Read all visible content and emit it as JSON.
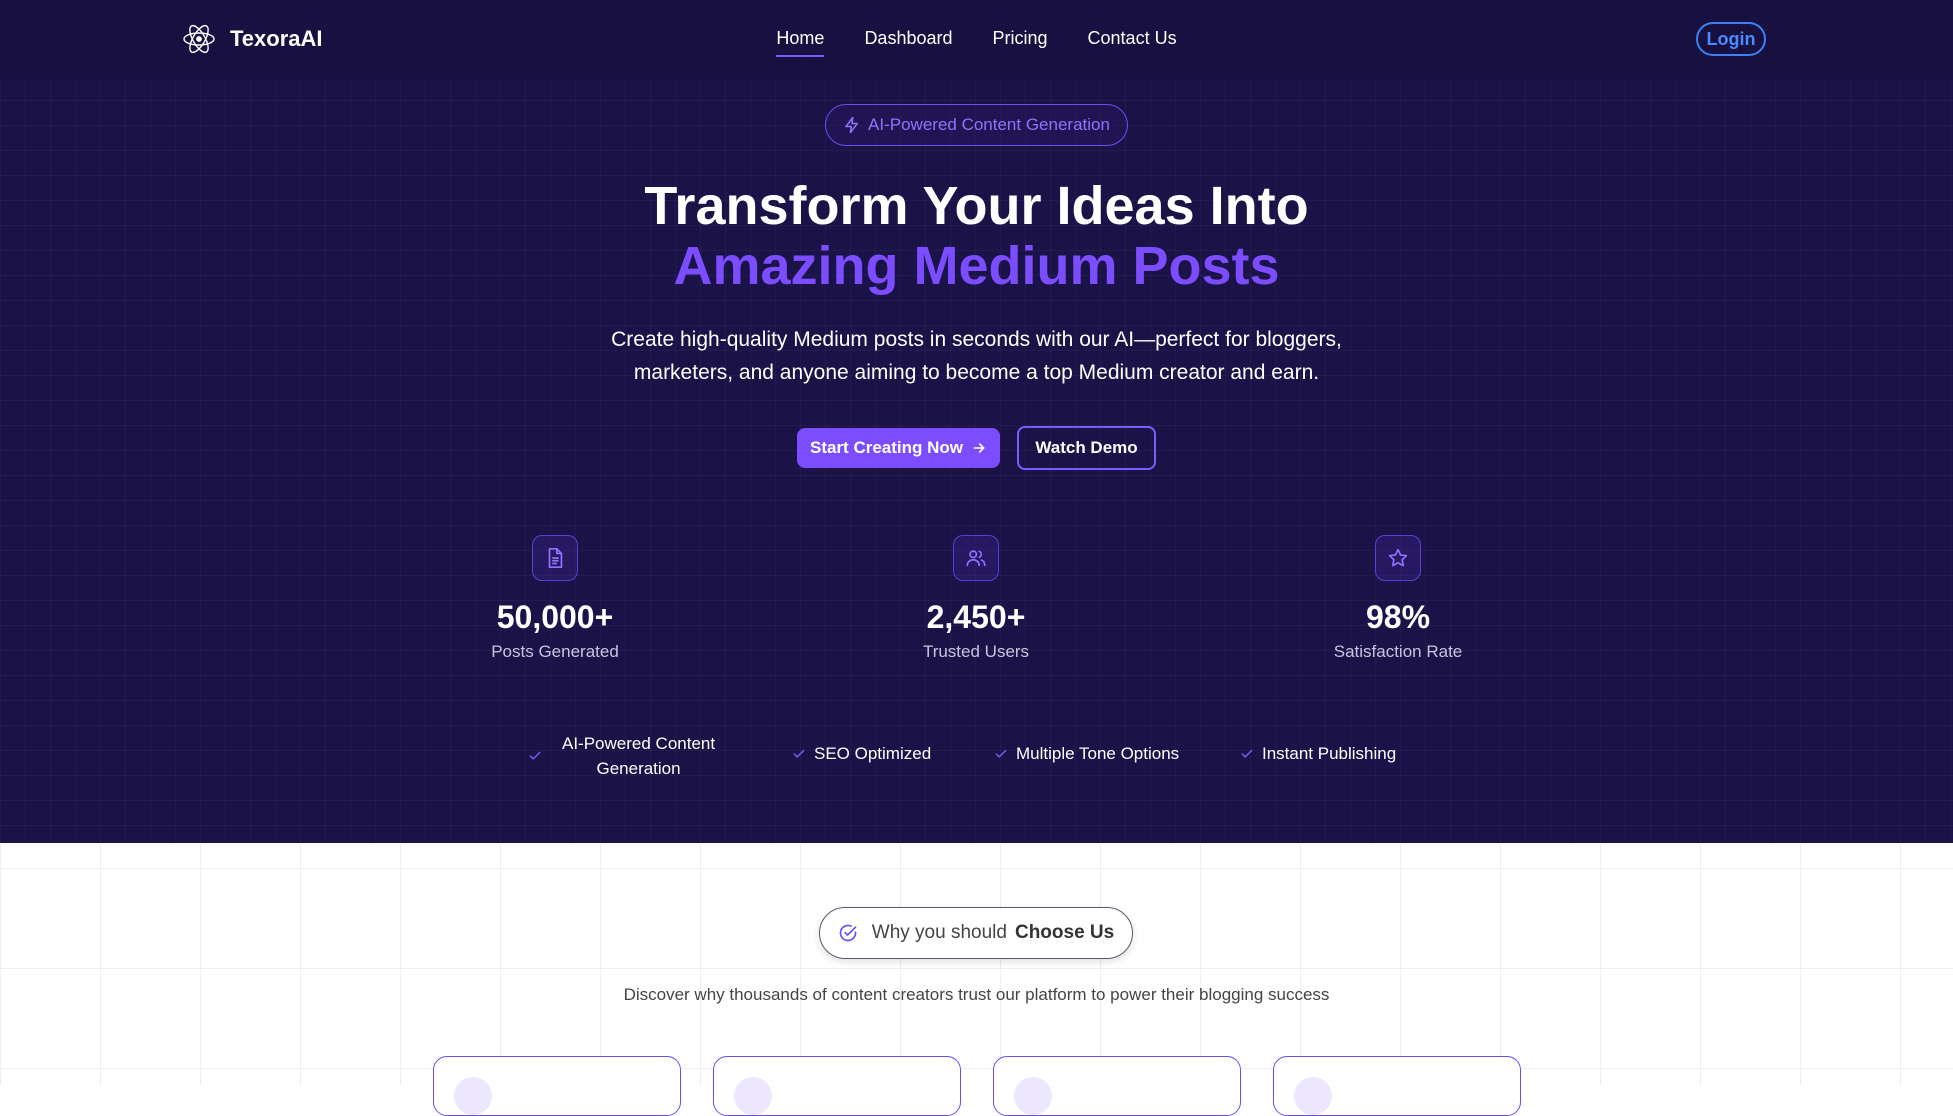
{
  "brand": {
    "name": "TexoraAI",
    "logo_icon": "atom-logo-icon"
  },
  "nav": {
    "links": [
      {
        "label": "Home",
        "active": true
      },
      {
        "label": "Dashboard",
        "active": false
      },
      {
        "label": "Pricing",
        "active": false
      },
      {
        "label": "Contact Us",
        "active": false
      }
    ],
    "login_label": "Login"
  },
  "hero": {
    "badge_label": "AI-Powered Content Generation",
    "headline_line1": "Transform Your Ideas Into",
    "headline_line2": "Amazing Medium Posts",
    "subtitle_line1": "Create high-quality Medium posts in seconds with our AI—perfect for bloggers,",
    "subtitle_line2": "marketers, and anyone aiming to become a top Medium creator and earn.",
    "cta_primary": "Start Creating Now",
    "cta_secondary": "Watch Demo"
  },
  "stats": [
    {
      "icon": "document-icon",
      "value": "50,000+",
      "label": "Posts Generated"
    },
    {
      "icon": "users-icon",
      "value": "2,450+",
      "label": "Trusted Users"
    },
    {
      "icon": "star-icon",
      "value": "98%",
      "label": "Satisfaction Rate"
    }
  ],
  "features": [
    {
      "line1": "AI-Powered Content",
      "line2": "Generation"
    },
    {
      "label": "SEO Optimized"
    },
    {
      "label": "Multiple Tone Options"
    },
    {
      "label": "Instant Publishing"
    }
  ],
  "why": {
    "badge_prefix": "Why you should",
    "badge_strong": "Choose Us",
    "description": "Discover why thousands of content creators trust our platform to power their blogging success"
  },
  "colors": {
    "hero_bg": "#1b1247",
    "accent": "#7c4dff",
    "login_border": "#3b82f6"
  }
}
